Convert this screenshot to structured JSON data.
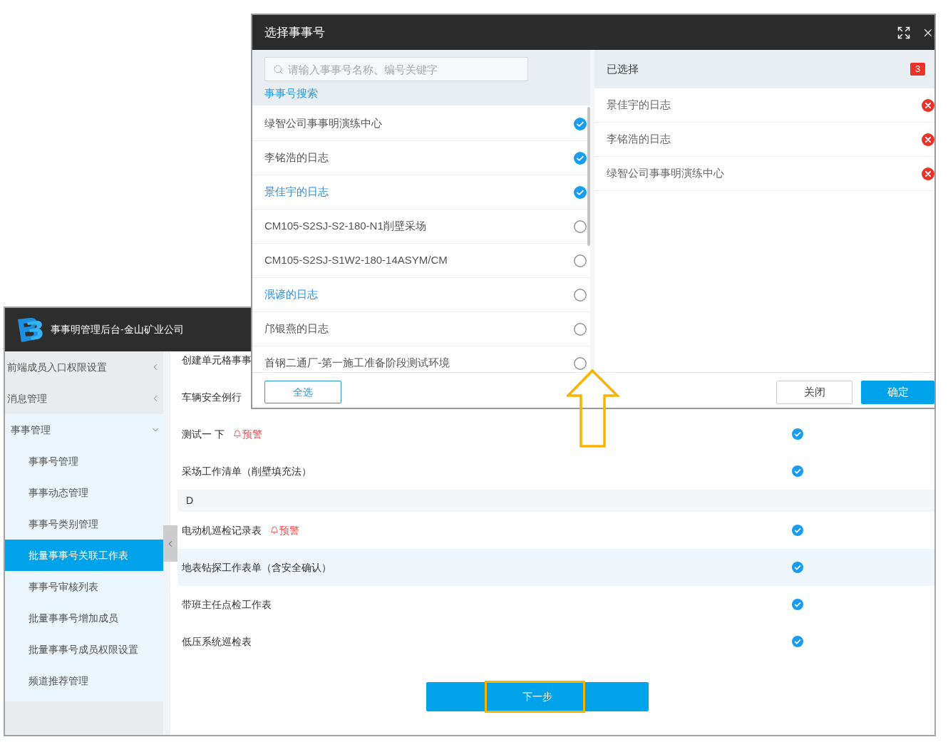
{
  "app": {
    "title": "事事明管理后台-金山矿业公司"
  },
  "sidebar": {
    "items": [
      {
        "label": "前端成员入口权限设置",
        "expanded": false
      },
      {
        "label": "消息管理",
        "expanded": false
      },
      {
        "label": "事事管理",
        "expanded": true,
        "children": [
          {
            "label": "事事号管理",
            "selected": false
          },
          {
            "label": "事事动态管理",
            "selected": false
          },
          {
            "label": "事事号类别管理",
            "selected": false
          },
          {
            "label": "批量事事号关联工作表",
            "selected": true
          },
          {
            "label": "事事号审核列表",
            "selected": false
          },
          {
            "label": "批量事事号增加成员",
            "selected": false
          },
          {
            "label": "批量事事号成员权限设置",
            "selected": false
          },
          {
            "label": "频道推荐管理",
            "selected": false
          }
        ]
      }
    ]
  },
  "content": {
    "rows": [
      {
        "kind": "item",
        "name": "创建单元格事事",
        "highlighted": false
      },
      {
        "kind": "item",
        "name": "车辆安全例行",
        "highlighted": false
      },
      {
        "kind": "item",
        "name": "测试一 下",
        "warning": "预警",
        "checked": true,
        "highlighted": false
      },
      {
        "kind": "item",
        "name": "采场工作清单（削壁填充法）",
        "checked": true,
        "highlighted": false
      },
      {
        "kind": "group",
        "label": "D"
      },
      {
        "kind": "item",
        "name": "电动机巡检记录表",
        "warning": "预警",
        "checked": true,
        "highlighted": false
      },
      {
        "kind": "item",
        "name": "地表钻探工作表单（含安全确认）",
        "checked": true,
        "highlighted": true
      },
      {
        "kind": "item",
        "name": "带班主任点检工作表",
        "checked": true,
        "highlighted": false
      },
      {
        "kind": "item",
        "name": "低压系统巡检表",
        "checked": true,
        "highlighted": false
      }
    ],
    "next_button": "下一步"
  },
  "dialog": {
    "title": "选择事事号",
    "search": {
      "placeholder": "请输入事事号名称、编号关键字"
    },
    "search_link": "事事号搜索",
    "options": [
      {
        "name": "绿智公司事事明演练中心",
        "selected": true,
        "highlighted": false
      },
      {
        "name": "李铭浩的日志",
        "selected": true,
        "highlighted": false
      },
      {
        "name": "景佳宇的日志",
        "selected": true,
        "highlighted": true
      },
      {
        "name": "CM105-S2SJ-S2-180-N1削壁采场",
        "selected": false,
        "highlighted": false
      },
      {
        "name": "CM105-S2SJ-S1W2-180-14ASYM/CM",
        "selected": false,
        "highlighted": false
      },
      {
        "name": "泯谚的日志",
        "selected": false,
        "highlighted": true
      },
      {
        "name": "邝银燕的日志",
        "selected": false,
        "highlighted": false
      },
      {
        "name": "首钢二通厂-第一施工准备阶段测试环境",
        "selected": false,
        "highlighted": false
      }
    ],
    "select_all_button": "全选",
    "selected_panel": {
      "title": "已选择",
      "count": "3",
      "items": [
        "景佳宇的日志",
        "李铭浩的日志",
        "绿智公司事事明演练中心"
      ]
    },
    "buttons": [
      {
        "label": "关闭",
        "kind": "secondary"
      },
      {
        "label": "确定",
        "kind": "primary"
      }
    ]
  }
}
